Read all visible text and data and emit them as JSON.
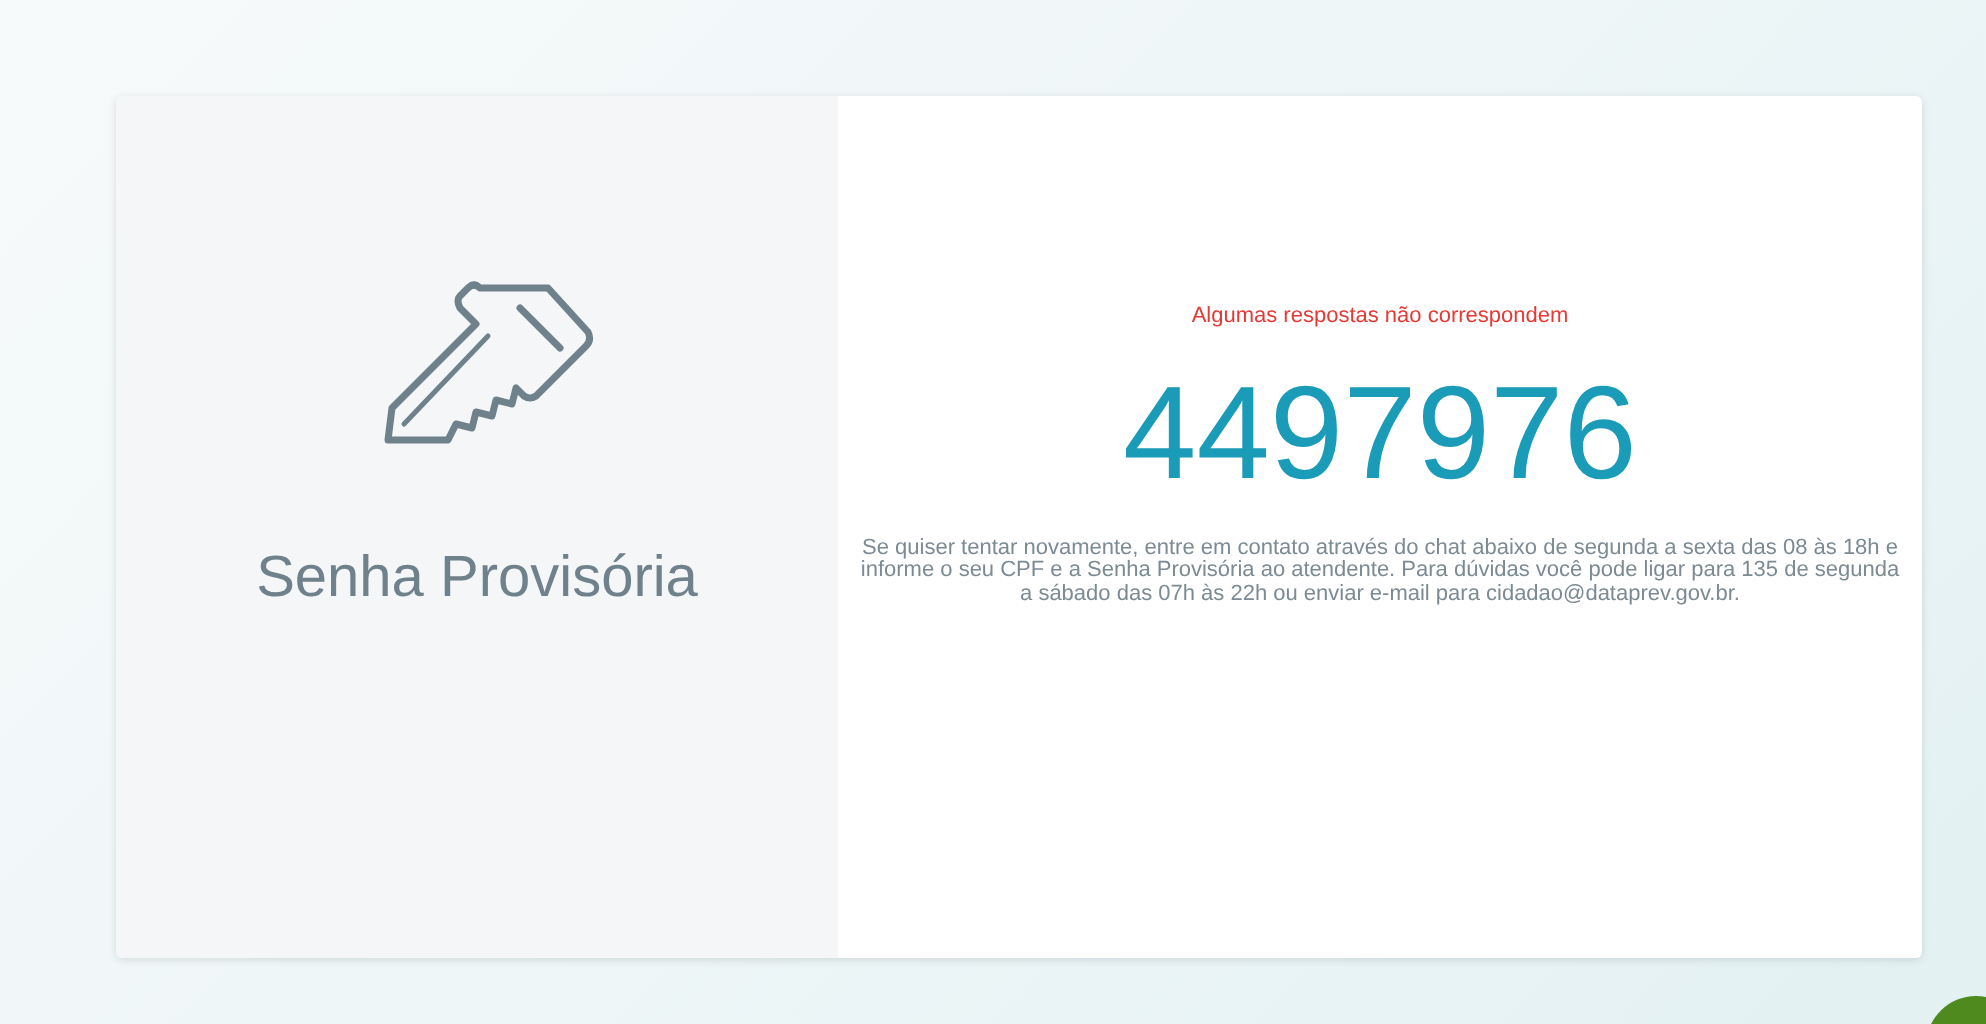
{
  "card": {
    "title": "Senha Provisória",
    "message": "Algumas respostas não correspondem",
    "password": "4497976",
    "instructions": "Se quiser tentar novamente, entre em contato através do chat abaixo de segunda a sexta das 08 às 18h e informe o seu CPF e a Senha Provisória ao atendente. Para dúvidas você pode ligar para 135 de segunda a sábado das 07h às 22h ou enviar e-mail para cidadao@dataprev.gov.br."
  }
}
